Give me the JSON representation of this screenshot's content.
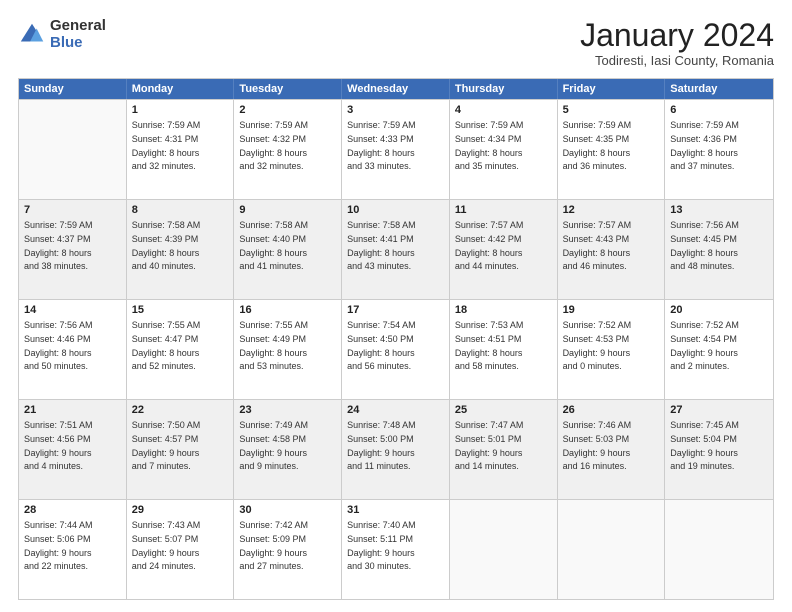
{
  "logo": {
    "general": "General",
    "blue": "Blue"
  },
  "title": "January 2024",
  "location": "Todiresti, Iasi County, Romania",
  "days": [
    "Sunday",
    "Monday",
    "Tuesday",
    "Wednesday",
    "Thursday",
    "Friday",
    "Saturday"
  ],
  "weeks": [
    [
      {
        "day": "",
        "info": ""
      },
      {
        "day": "1",
        "info": "Sunrise: 7:59 AM\nSunset: 4:31 PM\nDaylight: 8 hours\nand 32 minutes."
      },
      {
        "day": "2",
        "info": "Sunrise: 7:59 AM\nSunset: 4:32 PM\nDaylight: 8 hours\nand 32 minutes."
      },
      {
        "day": "3",
        "info": "Sunrise: 7:59 AM\nSunset: 4:33 PM\nDaylight: 8 hours\nand 33 minutes."
      },
      {
        "day": "4",
        "info": "Sunrise: 7:59 AM\nSunset: 4:34 PM\nDaylight: 8 hours\nand 35 minutes."
      },
      {
        "day": "5",
        "info": "Sunrise: 7:59 AM\nSunset: 4:35 PM\nDaylight: 8 hours\nand 36 minutes."
      },
      {
        "day": "6",
        "info": "Sunrise: 7:59 AM\nSunset: 4:36 PM\nDaylight: 8 hours\nand 37 minutes."
      }
    ],
    [
      {
        "day": "7",
        "info": "Sunrise: 7:59 AM\nSunset: 4:37 PM\nDaylight: 8 hours\nand 38 minutes."
      },
      {
        "day": "8",
        "info": "Sunrise: 7:58 AM\nSunset: 4:39 PM\nDaylight: 8 hours\nand 40 minutes."
      },
      {
        "day": "9",
        "info": "Sunrise: 7:58 AM\nSunset: 4:40 PM\nDaylight: 8 hours\nand 41 minutes."
      },
      {
        "day": "10",
        "info": "Sunrise: 7:58 AM\nSunset: 4:41 PM\nDaylight: 8 hours\nand 43 minutes."
      },
      {
        "day": "11",
        "info": "Sunrise: 7:57 AM\nSunset: 4:42 PM\nDaylight: 8 hours\nand 44 minutes."
      },
      {
        "day": "12",
        "info": "Sunrise: 7:57 AM\nSunset: 4:43 PM\nDaylight: 8 hours\nand 46 minutes."
      },
      {
        "day": "13",
        "info": "Sunrise: 7:56 AM\nSunset: 4:45 PM\nDaylight: 8 hours\nand 48 minutes."
      }
    ],
    [
      {
        "day": "14",
        "info": "Sunrise: 7:56 AM\nSunset: 4:46 PM\nDaylight: 8 hours\nand 50 minutes."
      },
      {
        "day": "15",
        "info": "Sunrise: 7:55 AM\nSunset: 4:47 PM\nDaylight: 8 hours\nand 52 minutes."
      },
      {
        "day": "16",
        "info": "Sunrise: 7:55 AM\nSunset: 4:49 PM\nDaylight: 8 hours\nand 53 minutes."
      },
      {
        "day": "17",
        "info": "Sunrise: 7:54 AM\nSunset: 4:50 PM\nDaylight: 8 hours\nand 56 minutes."
      },
      {
        "day": "18",
        "info": "Sunrise: 7:53 AM\nSunset: 4:51 PM\nDaylight: 8 hours\nand 58 minutes."
      },
      {
        "day": "19",
        "info": "Sunrise: 7:52 AM\nSunset: 4:53 PM\nDaylight: 9 hours\nand 0 minutes."
      },
      {
        "day": "20",
        "info": "Sunrise: 7:52 AM\nSunset: 4:54 PM\nDaylight: 9 hours\nand 2 minutes."
      }
    ],
    [
      {
        "day": "21",
        "info": "Sunrise: 7:51 AM\nSunset: 4:56 PM\nDaylight: 9 hours\nand 4 minutes."
      },
      {
        "day": "22",
        "info": "Sunrise: 7:50 AM\nSunset: 4:57 PM\nDaylight: 9 hours\nand 7 minutes."
      },
      {
        "day": "23",
        "info": "Sunrise: 7:49 AM\nSunset: 4:58 PM\nDaylight: 9 hours\nand 9 minutes."
      },
      {
        "day": "24",
        "info": "Sunrise: 7:48 AM\nSunset: 5:00 PM\nDaylight: 9 hours\nand 11 minutes."
      },
      {
        "day": "25",
        "info": "Sunrise: 7:47 AM\nSunset: 5:01 PM\nDaylight: 9 hours\nand 14 minutes."
      },
      {
        "day": "26",
        "info": "Sunrise: 7:46 AM\nSunset: 5:03 PM\nDaylight: 9 hours\nand 16 minutes."
      },
      {
        "day": "27",
        "info": "Sunrise: 7:45 AM\nSunset: 5:04 PM\nDaylight: 9 hours\nand 19 minutes."
      }
    ],
    [
      {
        "day": "28",
        "info": "Sunrise: 7:44 AM\nSunset: 5:06 PM\nDaylight: 9 hours\nand 22 minutes."
      },
      {
        "day": "29",
        "info": "Sunrise: 7:43 AM\nSunset: 5:07 PM\nDaylight: 9 hours\nand 24 minutes."
      },
      {
        "day": "30",
        "info": "Sunrise: 7:42 AM\nSunset: 5:09 PM\nDaylight: 9 hours\nand 27 minutes."
      },
      {
        "day": "31",
        "info": "Sunrise: 7:40 AM\nSunset: 5:11 PM\nDaylight: 9 hours\nand 30 minutes."
      },
      {
        "day": "",
        "info": ""
      },
      {
        "day": "",
        "info": ""
      },
      {
        "day": "",
        "info": ""
      }
    ]
  ]
}
